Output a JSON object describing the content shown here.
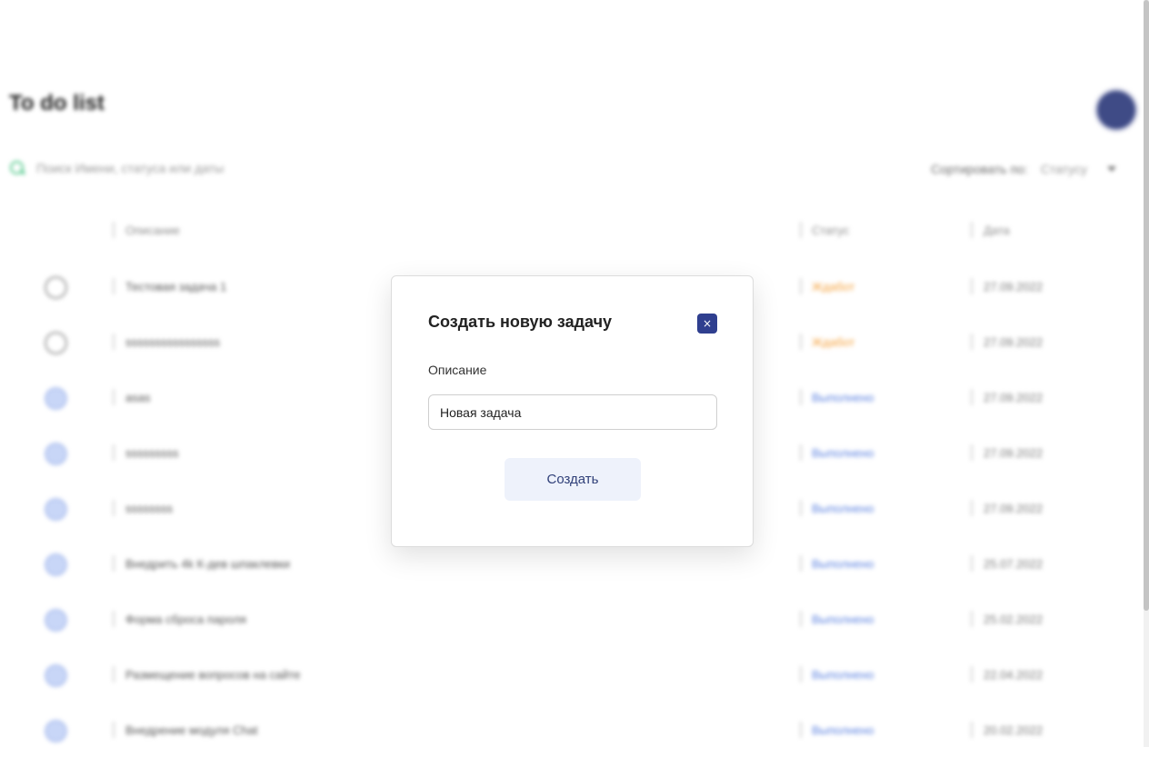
{
  "app": {
    "title": "To do list",
    "search_placeholder": "Поиск Имени, статуса или даты",
    "sort_label": "Сортировать по:",
    "sort_value": "Статусу",
    "table_headers": {
      "description": "Описание",
      "status": "Статус",
      "date": "Дата"
    },
    "rows": [
      {
        "done": false,
        "description": "Тестовая задача 1",
        "status": "Ждабот",
        "date": "27.09.2022"
      },
      {
        "done": false,
        "description": "ssssssssssssssss",
        "status": "Ждабот",
        "date": "27.09.2022"
      },
      {
        "done": true,
        "description": "asas",
        "status": "Выполнено",
        "date": "27.09.2022"
      },
      {
        "done": true,
        "description": "sssssssss",
        "status": "Выполнено",
        "date": "27.09.2022"
      },
      {
        "done": true,
        "description": "ssssssss",
        "status": "Выполнено",
        "date": "27.09.2022"
      },
      {
        "done": true,
        "description": "Внедрить 4k К-дев шпаклевки",
        "status": "Выполнено",
        "date": "25.07.2022"
      },
      {
        "done": true,
        "description": "Форма сброса пароля",
        "status": "Выполнено",
        "date": "25.02.2022"
      },
      {
        "done": true,
        "description": "Размещение вопросов на сайте",
        "status": "Выполнено",
        "date": "22.04.2022"
      },
      {
        "done": true,
        "description": "Внедрение модуля Chat",
        "status": "Выполнено",
        "date": "20.02.2022"
      }
    ]
  },
  "modal": {
    "title": "Создать новую задачу",
    "close_symbol": "×",
    "field_label": "Описание",
    "input_value": "Новая задача",
    "create_label": "Создать"
  },
  "colors": {
    "accent": "#2f3f8f",
    "status_in_work": "#f4a03a",
    "status_done": "#5c82e0",
    "search_icon": "#55c98d"
  },
  "icons": {
    "search": "search-icon",
    "close": "close-icon",
    "sort_dropdown": "chevron-down-icon",
    "row_check": "checkbox-circle-icon"
  }
}
